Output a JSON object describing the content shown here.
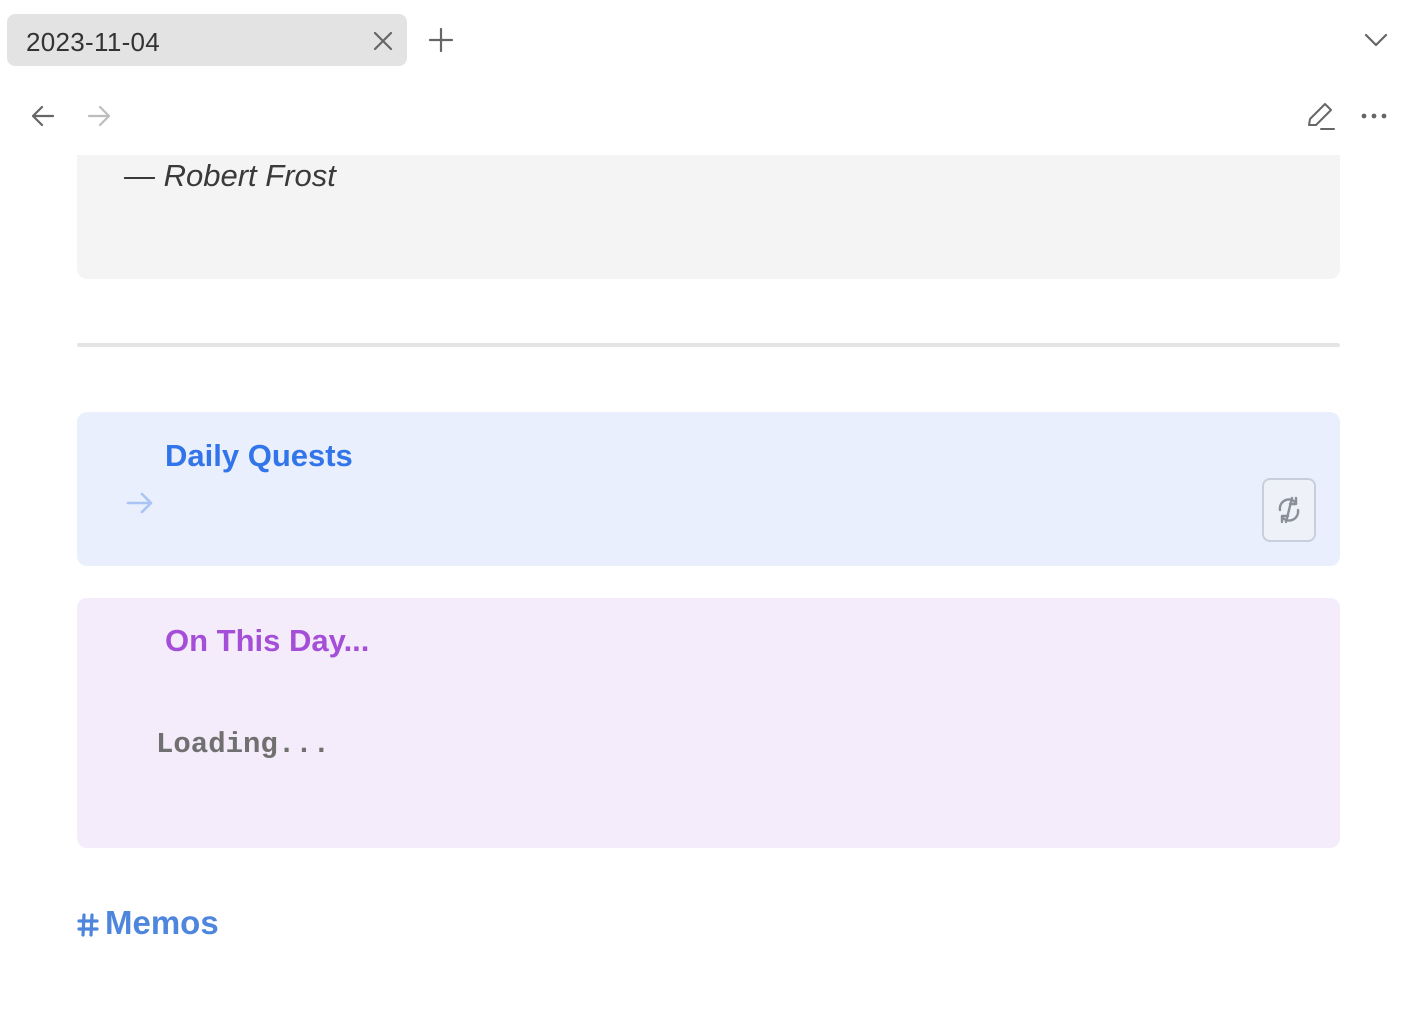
{
  "tabs": [
    {
      "title": "2023-11-04",
      "active": true
    }
  ],
  "icons": {
    "tab_close": "close-icon",
    "new_tab": "plus-icon",
    "tab_list": "chevron-down-icon",
    "back": "arrow-left-icon",
    "forward": "arrow-right-icon",
    "edit": "pencil-icon",
    "more": "more-horizontal-icon",
    "quest_arrow": "arrow-right-icon",
    "refresh": "refresh-icon",
    "tag": "hash-icon"
  },
  "content": {
    "quote": {
      "author": "— Robert Frost"
    },
    "callouts": {
      "quests": {
        "title": "Daily Quests",
        "color": "#3274ea",
        "background": "#e9effd"
      },
      "on_this_day": {
        "title": "On This Day...",
        "body": "Loading...",
        "color": "#a54fd8",
        "background": "#f4ecfa"
      }
    },
    "memos": {
      "label": "Memos",
      "color": "#4f86dd"
    }
  }
}
